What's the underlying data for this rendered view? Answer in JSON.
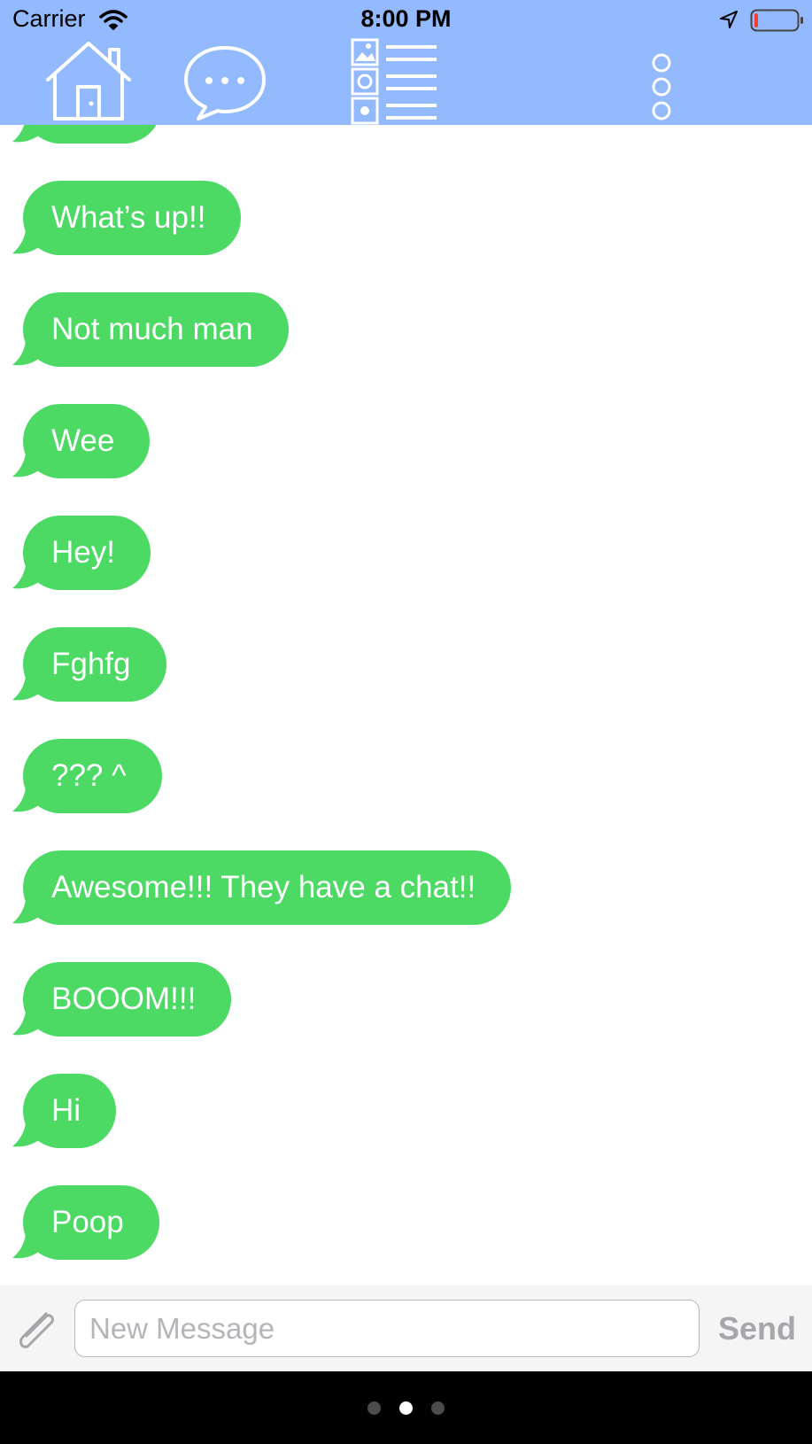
{
  "status_bar": {
    "carrier": "Carrier",
    "time": "8:00 PM",
    "battery_level": 0.08
  },
  "header": {
    "background_color": "#93b9fe",
    "icons": [
      "home-icon",
      "chat-bubble-icon",
      "gallery-list-icon",
      "more-vertical-icon"
    ]
  },
  "messages": [
    {
      "text": ""
    },
    {
      "text": "What’s up!!"
    },
    {
      "text": "Not much man"
    },
    {
      "text": "Wee"
    },
    {
      "text": "Hey!"
    },
    {
      "text": "Fghfg"
    },
    {
      "text": "??? ^"
    },
    {
      "text": "Awesome!!! They have a chat!!"
    },
    {
      "text": "BOOOM!!!"
    },
    {
      "text": "Hi"
    },
    {
      "text": "Poop"
    }
  ],
  "bubble_color": "#4cd964",
  "input_bar": {
    "placeholder": "New Message",
    "value": "",
    "send_label": "Send",
    "attach_icon": "paperclip-icon"
  },
  "page_control": {
    "pages": 3,
    "current": 2
  }
}
